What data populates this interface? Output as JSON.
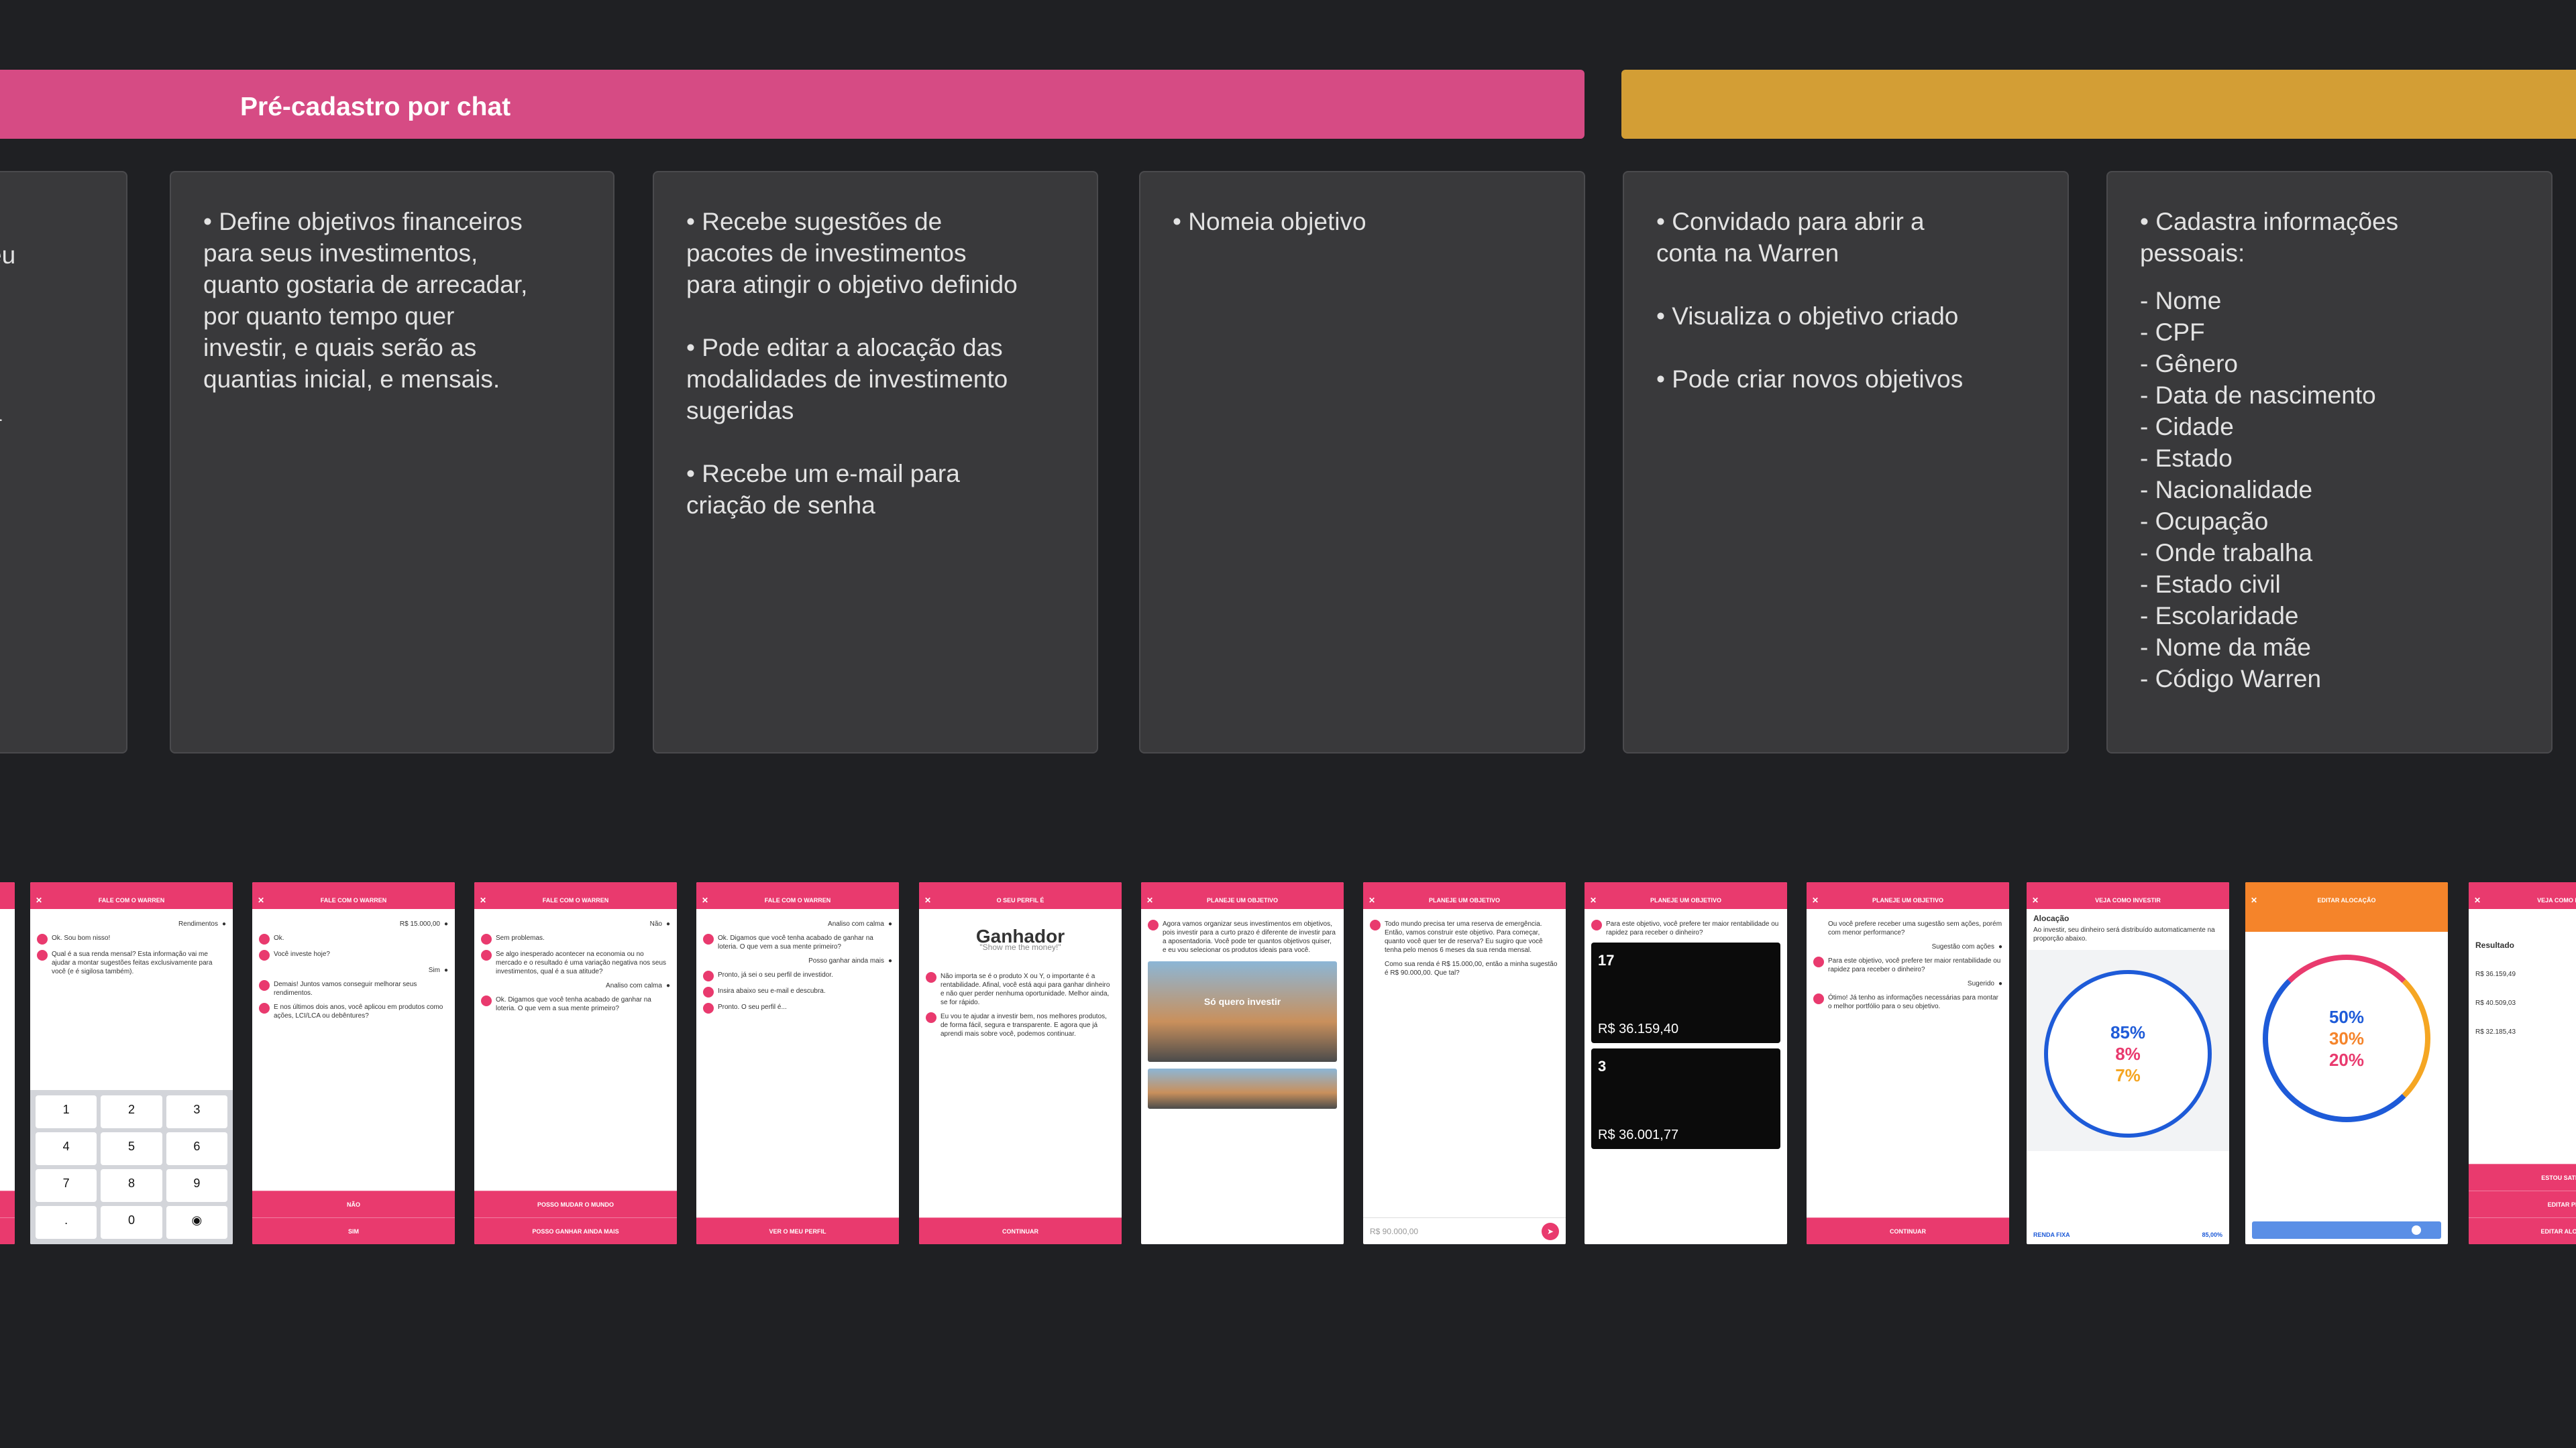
{
  "phases": {
    "pink": {
      "title": "Pré-cadastro por chat",
      "color": "#d64b84"
    },
    "gold": {
      "title": "",
      "color": "#d39e35"
    }
  },
  "card_fragment": {
    "line1": "eu",
    "line2": "a"
  },
  "cards": {
    "objetivos": {
      "text": "• Define objetivos financeiros\npara seus investimentos,\nquanto gostaria de arrecadar,\npor quanto tempo quer\ninvestir, e quais serão as\nquantias inicial, e mensais."
    },
    "sugestoes": {
      "p1": "• Recebe sugestões de\npacotes de investimentos\npara atingir o objetivo definido",
      "p2": "• Pode editar a alocação das\nmodalidades de investimento\nsugeridas",
      "p3": "• Recebe um e-mail para\ncriação de senha"
    },
    "nomeia": {
      "text": "• Nomeia objetivo"
    },
    "convidado": {
      "p1": "• Convidado para abrir a\nconta na Warren",
      "p2": "• Visualiza o objetivo criado",
      "p3": "• Pode criar novos objetivos"
    },
    "cadastra": {
      "intro": "• Cadastra informações\npessoais:",
      "items": [
        "- Nome",
        "- CPF",
        "- Gênero",
        "- Data de nascimento",
        "- Cidade",
        "- Estado",
        "- Nacionalidade",
        "- Ocupação",
        "- Onde trabalha",
        "- Estado civil",
        "- Escolaridade",
        "- Nome da mãe",
        "- Código Warren"
      ]
    }
  },
  "phones": {
    "p1": {
      "header": "Fale com o Warren",
      "m1": "Ok. Sou bom nisso!",
      "m2": "Qual é a sua renda mensal? Esta informação vai me ajudar a montar sugestões feitas exclusivamente para você (e é sigilosa também).",
      "reply": "Rendimentos"
    },
    "p2": {
      "header": "Fale com o Warren",
      "reply1": "R$ 15.000,00",
      "m1": "Ok.",
      "m2": "Você investe hoje?",
      "reply2": "Sim",
      "m3": "Demais! Juntos vamos conseguir melhorar seus rendimentos.",
      "m4": "E nos últimos dois anos, você aplicou em produtos como ações, LCI/LCA ou debêntures?",
      "btn1": "Não",
      "btn2": "Sim"
    },
    "p3": {
      "header": "Fale com o Warren",
      "reply1": "Não",
      "m1": "Sem problemas.",
      "m2": "Se algo inesperado acontecer na economia ou no mercado e o resultado é uma variação negativa nos seus investimentos, qual é a sua atitude?",
      "reply2": "Analiso com calma",
      "m3": "Ok. Digamos que você tenha acabado de ganhar na loteria. O que vem a sua mente primeiro?",
      "btn1": "Posso mudar o mundo",
      "btn2": "Posso ganhar ainda mais"
    },
    "p4": {
      "header": "Fale com o Warren",
      "reply1": "Analiso com calma",
      "m1": "Ok. Digamos que você tenha acabado de ganhar na loteria. O que vem a sua mente primeiro?",
      "reply2": "Posso ganhar ainda mais",
      "m2": "Pronto, já sei o seu perfil de investidor.",
      "m3": "Insira abaixo seu e-mail e descubra.",
      "m4": "Pronto. O seu perfil é...",
      "btn1": "Ver o meu perfil"
    },
    "p5": {
      "header": "O seu perfil é",
      "title": "Ganhador",
      "subtitle": "\"Show me the money!\"",
      "m1": "Não importa se é o produto X ou Y, o importante é a rentabilidade. Afinal, você está aqui para ganhar dinheiro e não quer perder nenhuma oportunidade. Melhor ainda, se for rápido.",
      "m2": "Eu vou te ajudar a investir bem, nos melhores produtos, de forma fácil, segura e transparente. E agora que já aprendi mais sobre você, podemos continuar.",
      "btn1": "Continuar"
    },
    "p6": {
      "header": "Planeje um objetivo",
      "m1": "Agora vamos organizar seus investimentos em objetivos, pois investir para a curto prazo é diferente de investir para a aposentadoria. Você pode ter quantos objetivos quiser, e eu vou selecionar os produtos ideais para você.",
      "img": "Só quero investir"
    },
    "p7": {
      "header": "Planeje um objetivo",
      "m1": "Todo mundo precisa ter uma reserva de emergência. Então, vamos construir este objetivo. Para começar, quanto você quer ter de reserva? Eu sugiro que você tenha pelo menos 6 meses da sua renda mensal.",
      "m2": "Como sua renda é R$ 15.000,00, então a minha sugestão é R$ 90.000,00. Que tal?",
      "input": "R$ 90.000,00"
    },
    "p8": {
      "header": "Planeje um objetivo",
      "m1": "Para este objetivo, você prefere ter maior rentabilidade ou rapidez para receber o dinheiro?",
      "c1_big": "17",
      "c1_val": "R$ 36.159,40",
      "c2_big": "3",
      "c2_val": "R$ 36.001,77"
    },
    "p9": {
      "header": "Planeje um objetivo",
      "m1": "Ou você prefere receber uma sugestão sem ações, porém com menor performance?",
      "reply1": "Sugestão com ações",
      "m2": "Para este objetivo, você prefere ter maior rentabilidade ou rapidez para receber o dinheiro?",
      "reply2": "Sugerido",
      "m3": "Ótimo! Já tenho as informações necessárias para montar o melhor portfólio para o seu objetivo.",
      "btn1": "Continuar"
    },
    "p10": {
      "header": "Veja como investir",
      "title": "Alocação",
      "text": "Ao investir, seu dinheiro será distribuído automaticamente na proporção abaixo.",
      "v1": "85%",
      "v2": "8%",
      "v3": "7%",
      "foot_l": "Renda Fixa",
      "foot_r": "85,00%"
    },
    "p11": {
      "header": "Editar alocação",
      "v1": "50%",
      "v2": "30%",
      "v3": "20%"
    },
    "p12": {
      "header": "Veja como investir",
      "title": "Resultado",
      "r1": "R$ 36.159,49",
      "r2": "R$ 40.509,03",
      "r3": "R$ 32.185,43",
      "btn1": "Estou satisfeito",
      "btn2": "Editar plano",
      "btn3": "Editar alocação"
    }
  },
  "colors": {
    "accent_pink": "#e93a6e",
    "accent_orange": "#f5842a",
    "card_bg": "#39393b",
    "canvas_bg": "#1f2023"
  }
}
